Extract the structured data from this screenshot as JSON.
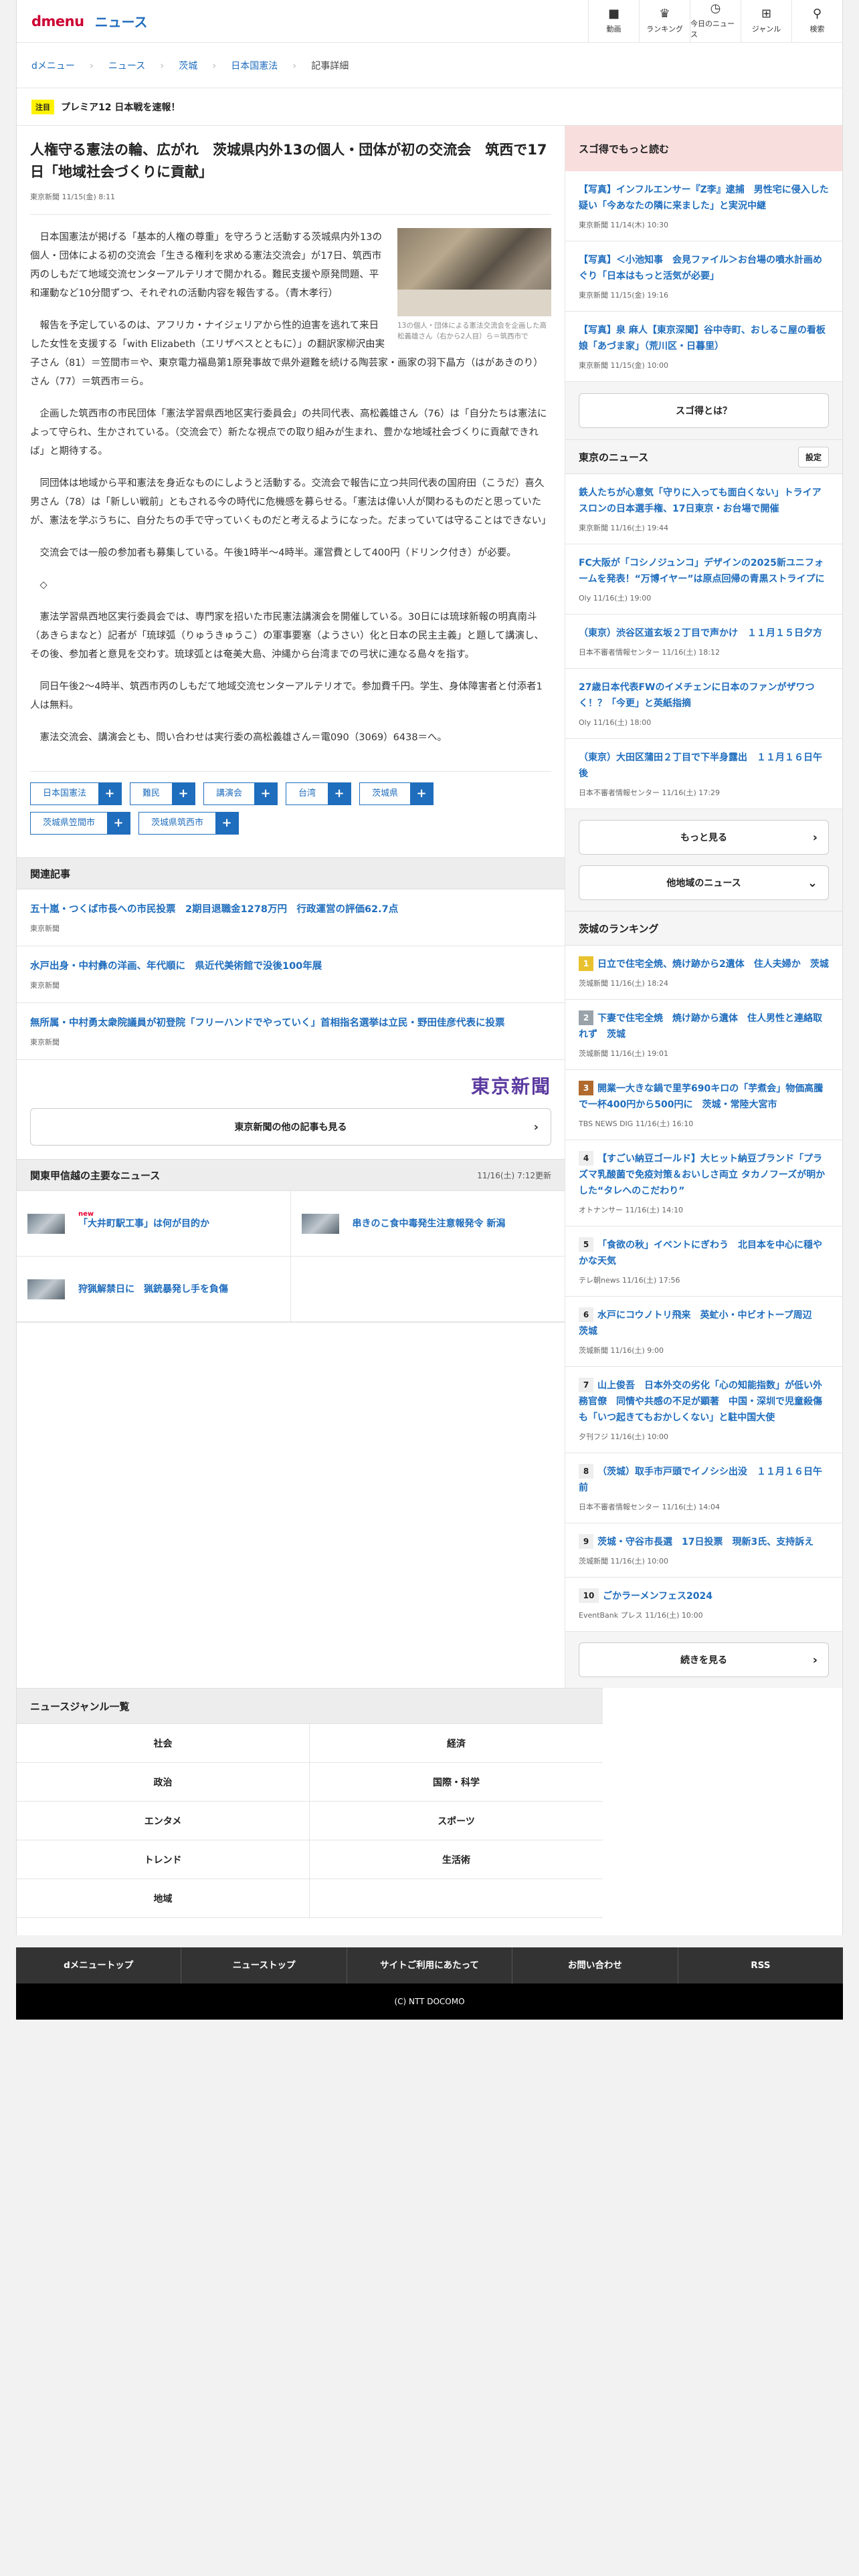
{
  "header": {
    "logo": "dmenu",
    "section": "ニュース",
    "nav": [
      {
        "icon": "video-icon",
        "glyph": "■",
        "label": "動画"
      },
      {
        "icon": "trophy-icon",
        "glyph": "♛",
        "label": "ランキング"
      },
      {
        "icon": "clock-icon",
        "glyph": "◷",
        "label": "今日のニュース"
      },
      {
        "icon": "grid-icon",
        "glyph": "⊞",
        "label": "ジャンル"
      },
      {
        "icon": "search-icon",
        "glyph": "⚲",
        "label": "検索"
      }
    ]
  },
  "breadcrumb": [
    "dメニュー",
    "ニュース",
    "茨城",
    "日本国憲法",
    "記事詳細"
  ],
  "ticker": {
    "badge": "注目",
    "text": "プレミア12 日本戦を速報！"
  },
  "article": {
    "title": "人権守る憲法の輪、広がれ　茨城県内外13の個人・団体が初の交流会　筑西で17日「地域社会づくりに貢献」",
    "meta": "東京新聞 11/15(金) 8:11",
    "photo_caption": "13の個人・団体による憲法交流会を企画した高松義雄さん（右から2人目）ら＝筑西市で",
    "paragraphs": [
      "日本国憲法が掲げる「基本的人権の尊重」を守ろうと活動する茨城県内外13の個人・団体による初の交流会「生きる権利を求める憲法交流会」が17日、筑西市丙のしもだて地域交流センターアルテリオで開かれる。難民支援や原発問題、平和運動など10分間ずつ、それぞれの活動内容を報告する。（青木孝行）",
      "報告を予定しているのは、アフリカ・ナイジェリアから性的迫害を逃れて来日した女性を支援する「with Elizabeth（エリザベスとともに）」の翻訳家柳沢由実子さん（81）＝笠間市＝や、東京電力福島第1原発事故で県外避難を続ける陶芸家・画家の羽下晶方（はがあきのり）さん（77）＝筑西市＝ら。",
      "企画した筑西市の市民団体「憲法学習県西地区実行委員会」の共同代表、高松義雄さん（76）は「自分たちは憲法によって守られ、生かされている。（交流会で）新たな視点での取り組みが生まれ、豊かな地域社会づくりに貢献できれば」と期待する。",
      "同団体は地域から平和憲法を身近なものにしようと活動する。交流会で報告に立つ共同代表の国府田（こうだ）喜久男さん（78）は「新しい戦前」ともされる今の時代に危機感を募らせる。「憲法は偉い人が関わるものだと思っていたが、憲法を学ぶうちに、自分たちの手で守っていくものだと考えるようになった。だまっていては守ることはできない」",
      "交流会では一般の参加者も募集している。午後1時半〜4時半。運営費として400円（ドリンク付き）が必要。",
      "◇",
      "憲法学習県西地区実行委員会では、専門家を招いた市民憲法講演会を開催している。30日には琉球新報の明真南斗（あきらまなと）記者が「琉球弧（りゅうきゅうこ）の軍事要塞（ようさい）化と日本の民主主義」と題して講演し、その後、参加者と意見を交わす。琉球弧とは奄美大島、沖縄から台湾までの弓状に連なる島々を指す。",
      "同日午後2〜4時半、筑西市丙のしもだて地域交流センターアルテリオで。参加費千円。学生、身体障害者と付添者1人は無料。",
      "憲法交流会、講演会とも、問い合わせは実行委の高松義雄さん＝電090（3069）6438＝へ。"
    ],
    "tags": [
      "日本国憲法",
      "難民",
      "講演会",
      "台湾",
      "茨城県",
      "茨城県笠間市",
      "茨城県筑西市"
    ]
  },
  "related": {
    "heading": "関連記事",
    "items": [
      {
        "title": "五十嵐・つくば市長への市民投票　2期目退職金1278万円　行政運営の評価62.7点",
        "source": "東京新聞"
      },
      {
        "title": "水戸出身・中村彝の洋画、年代順に　県近代美術館で没後100年展",
        "source": "東京新聞"
      },
      {
        "title": "無所属・中村勇太衆院議員が初登院「フリーハンドでやっていく」首相指名選挙は立民・野田佳彦代表に投票",
        "source": "東京新聞"
      }
    ],
    "publisher_logo": "東京新聞",
    "more": "東京新聞の他の記事も見る"
  },
  "kanto": {
    "heading": "関東甲信越の主要なニュース",
    "updated": "11/16(土) 7:12更新",
    "items": [
      {
        "title": "「大井町駅工事」は何が目的か",
        "new": "new"
      },
      {
        "title": "串きのこ食中毒発生注意報発令 新潟",
        "new": ""
      },
      {
        "title": "狩猟解禁日に　猟銃暴発し手を負傷",
        "new": ""
      }
    ]
  },
  "suga": {
    "heading": "スゴ得でもっと読む",
    "items": [
      {
        "title": "【写真】インフルエンサー『Z李』逮捕　男性宅に侵入した疑い「今あなたの隣に来ました」と実況中継",
        "source": "東京新聞 11/14(木) 10:30"
      },
      {
        "title": "【写真】＜小池知事　会見ファイル＞お台場の噴水計画めぐり「日本はもっと活気が必要」",
        "source": "東京新聞 11/15(金) 19:16"
      },
      {
        "title": "【写真】泉 麻人【東京深聞】谷中寺町、おしるこ屋の看板娘「あづま家」（荒川区・日暮里）",
        "source": "東京新聞 11/15(金) 10:00"
      }
    ],
    "button": "スゴ得とは？"
  },
  "tokyo": {
    "heading": "東京のニュース",
    "settings": "設定",
    "items": [
      {
        "title": "鉄人たちが心意気「守りに入っても面白くない」トライアスロンの日本選手権、17日東京・お台場で開催",
        "source": "東京新聞 11/16(土) 19:44"
      },
      {
        "title": "FC大阪が「コシノジュンコ」デザインの2025新ユニフォームを発表！“万博イヤー”は原点回帰の青黒ストライプに",
        "source": "Oly 11/16(土) 19:00"
      },
      {
        "title": "（東京）渋谷区道玄坂２丁目で声かけ　１１月１５日夕方",
        "source": "日本不審者情報センター 11/16(土) 18:12"
      },
      {
        "title": "27歳日本代表FWのイメチェンに日本のファンがザワつく！？「今更」と英紙指摘",
        "source": "Oly 11/16(土) 18:00"
      },
      {
        "title": "（東京）大田区蒲田２丁目で下半身露出　１１月１６日午後",
        "source": "日本不審者情報センター 11/16(土) 17:29"
      }
    ],
    "more": "もっと見る",
    "other": "他地域のニュース"
  },
  "ranking": {
    "heading": "茨城のランキング",
    "items": [
      {
        "rank": "1",
        "title": "日立で住宅全焼、焼け跡から2遺体　住人夫婦か　茨城",
        "source": "茨城新聞 11/16(土) 18:24"
      },
      {
        "rank": "2",
        "title": "下妻で住宅全焼　焼け跡から遺体　住人男性と連絡取れず　茨城",
        "source": "茨城新聞 11/16(土) 19:01"
      },
      {
        "rank": "3",
        "title": "開業一大きな鍋で里芋690キロの「芋煮会」物価高騰で一杯400円から500円に　茨城・常陸大宮市",
        "source": "TBS NEWS DIG 11/16(土) 16:10"
      },
      {
        "rank": "4",
        "title": "【すごい納豆ゴールド】大ヒット納豆ブランド「プラズマ乳酸菌で免疫対策＆おいしさ両立 タカノフーズが明かした“タレへのこだわり”",
        "source": "オトナンサー 11/16(土) 14:10"
      },
      {
        "rank": "5",
        "title": "「食欲の秋」イベントにぎわう　北目本を中心に穏やかな天気",
        "source": "テレ朝news 11/16(土) 17:56"
      },
      {
        "rank": "6",
        "title": "水戸にコウノトリ飛来　英虻小・中ビオトープ周辺　茨城",
        "source": "茨城新聞 11/16(土) 9:00"
      },
      {
        "rank": "7",
        "title": "山上俊吾　日本外交の劣化「心の知能指数」が低い外務官僚　同情や共感の不足が顕著　中国・深圳で児童殺傷も「いつ起きてもおかしくない」と駐中国大使",
        "source": "夕刊フジ 11/16(土) 10:00"
      },
      {
        "rank": "8",
        "title": "（茨城）取手市戸頭でイノシシ出没　１１月１６日午前",
        "source": "日本不審者情報センター 11/16(土) 14:04"
      },
      {
        "rank": "9",
        "title": "茨城・守谷市長選　17日投票　現新3氏、支持訴え",
        "source": "茨城新聞 11/16(土) 10:00"
      },
      {
        "rank": "10",
        "title": "ごかラーメンフェス2024",
        "source": "EventBank プレス 11/16(土) 10:00"
      }
    ],
    "more": "続きを見る"
  },
  "genre": {
    "heading": "ニュースジャンル一覧",
    "items": [
      "社会",
      "経済",
      "政治",
      "国際・科学",
      "エンタメ",
      "スポーツ",
      "トレンド",
      "生活術",
      "地域",
      ""
    ]
  },
  "footer": {
    "nav": [
      "dメニュートップ",
      "ニューストップ",
      "サイトご利用にあたって",
      "お問い合わせ",
      "RSS"
    ],
    "copyright": "(C) NTT DOCOMO"
  },
  "colors": {
    "brand": "#cc0033",
    "link": "#1f6dbd",
    "suga_header": "#f9dede"
  }
}
